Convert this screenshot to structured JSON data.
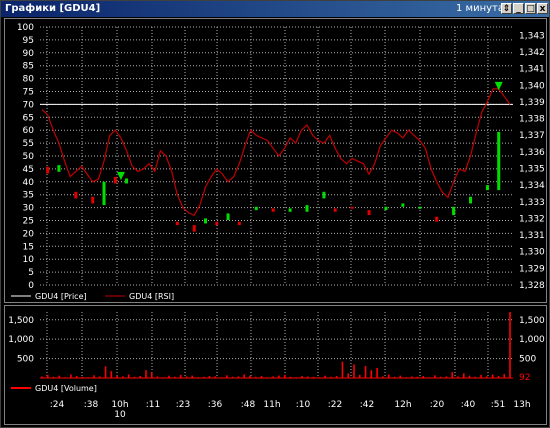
{
  "window": {
    "title": "Графики [GDU4]",
    "timeframe": "1 минута",
    "buttons": [
      "⇕",
      "_",
      "□",
      "x"
    ]
  },
  "colors": {
    "background": "#000000",
    "grid": "#b0b0b0",
    "price_up": "#00e000",
    "price_down": "#e00000",
    "rsi_line": "#c00000",
    "rsi_level": "#ffffff",
    "volume": "#ff0000",
    "text": "#ffffff"
  },
  "chart_data": [
    {
      "type": "line",
      "title": "",
      "left_axis": {
        "ylim": [
          0,
          100
        ],
        "ticks": [
          "0",
          "5",
          "10",
          "15",
          "20",
          "25",
          "30",
          "35",
          "40",
          "45",
          "50",
          "55",
          "60",
          "65",
          "70",
          "75",
          "80",
          "85",
          "90",
          "95",
          "100"
        ]
      },
      "right_axis": {
        "ylim": [
          1.328,
          1.3435
        ],
        "ticks": [
          "1,328",
          "1,329",
          "1,330",
          "1,331",
          "1,332",
          "1,333",
          "1,334",
          "1,335",
          "1,336",
          "1,337",
          "1,338",
          "1,339",
          "1,340",
          "1,341",
          "1,342",
          "1,343"
        ]
      },
      "rsi_level": 70,
      "grid": true,
      "legend": [
        "GDU4 [Price]",
        "GDU4 [RSI]"
      ],
      "legend_placement": "bottom-left",
      "series": [
        {
          "name": "GDU4 [RSI]",
          "values": [
            68,
            66,
            60,
            55,
            48,
            42,
            44,
            46,
            43,
            40,
            41,
            48,
            58,
            60,
            57,
            52,
            46,
            44,
            45,
            47,
            44,
            52,
            50,
            44,
            35,
            30,
            28,
            27,
            31,
            38,
            42,
            45,
            43,
            40,
            42,
            47,
            54,
            60,
            58,
            57,
            56,
            53,
            50,
            53,
            57,
            55,
            60,
            62,
            58,
            56,
            55,
            58,
            53,
            49,
            47,
            49,
            48,
            47,
            43,
            47,
            54,
            57,
            60,
            59,
            57,
            60,
            58,
            56,
            53,
            45,
            40,
            36,
            34,
            40,
            45,
            44,
            50,
            59,
            67,
            71,
            76,
            76,
            73,
            70
          ]
        },
        {
          "name": "GDU4 [Price]",
          "type": "candlestick",
          "candles": [
            {
              "i": 1,
              "o": 1.3351,
              "c": 1.3347
            },
            {
              "i": 3,
              "o": 1.3348,
              "c": 1.3352
            },
            {
              "i": 6,
              "o": 1.3336,
              "c": 1.3332
            },
            {
              "i": 9,
              "o": 1.3333,
              "c": 1.3329
            },
            {
              "i": 11,
              "o": 1.3328,
              "c": 1.3342
            },
            {
              "i": 13,
              "o": 1.3345,
              "c": 1.3341
            },
            {
              "i": 15,
              "o": 1.3341,
              "c": 1.3344
            },
            {
              "i": 24,
              "o": 1.3318,
              "c": 1.3316
            },
            {
              "i": 27,
              "o": 1.3316,
              "c": 1.3312
            },
            {
              "i": 29,
              "o": 1.3317,
              "c": 1.332
            },
            {
              "i": 31,
              "o": 1.3318,
              "c": 1.3316
            },
            {
              "i": 33,
              "o": 1.3319,
              "c": 1.3323
            },
            {
              "i": 35,
              "o": 1.3318,
              "c": 1.3316
            },
            {
              "i": 38,
              "o": 1.3325,
              "c": 1.3327
            },
            {
              "i": 41,
              "o": 1.3326,
              "c": 1.3324
            },
            {
              "i": 44,
              "o": 1.3324,
              "c": 1.3326
            },
            {
              "i": 47,
              "o": 1.3324,
              "c": 1.3328
            },
            {
              "i": 50,
              "o": 1.3332,
              "c": 1.3336
            },
            {
              "i": 52,
              "o": 1.3326,
              "c": 1.3324
            },
            {
              "i": 55,
              "o": 1.3327,
              "c": 1.3326
            },
            {
              "i": 58,
              "o": 1.3325,
              "c": 1.3322
            },
            {
              "i": 61,
              "o": 1.3325,
              "c": 1.3327
            },
            {
              "i": 64,
              "o": 1.3327,
              "c": 1.3329
            },
            {
              "i": 67,
              "o": 1.3326,
              "c": 1.3327
            },
            {
              "i": 70,
              "o": 1.3321,
              "c": 1.3318
            },
            {
              "i": 73,
              "o": 1.3322,
              "c": 1.3327
            },
            {
              "i": 76,
              "o": 1.3329,
              "c": 1.3333
            },
            {
              "i": 79,
              "o": 1.3337,
              "c": 1.334
            },
            {
              "i": 81,
              "o": 1.3337,
              "c": 1.3372
            }
          ]
        }
      ]
    },
    {
      "type": "bar",
      "title": "",
      "legend": [
        "GDU4 [Volume]"
      ],
      "legend_placement": "bottom-left",
      "ylim": [
        0,
        1700
      ],
      "ticks": [
        "1,500",
        "1,000",
        "500"
      ],
      "last_value": "92",
      "values": [
        40,
        80,
        30,
        60,
        20,
        90,
        50,
        30,
        20,
        70,
        40,
        300,
        180,
        60,
        40,
        90,
        30,
        50,
        200,
        150,
        40,
        20,
        60,
        30,
        80,
        40,
        60,
        20,
        30,
        50,
        40,
        20,
        70,
        30,
        40,
        90,
        60,
        30,
        50,
        20,
        40,
        60,
        80,
        30,
        20,
        50,
        40,
        30,
        20,
        60,
        30,
        50,
        420,
        120,
        350,
        80,
        310,
        200,
        260,
        40,
        90,
        30,
        60,
        20,
        40,
        30,
        50,
        20,
        70,
        30,
        40,
        150,
        40,
        120,
        60,
        30,
        80,
        40,
        90,
        50,
        100,
        1700
      ]
    }
  ],
  "x_axis": {
    "ticks": [
      ":24",
      ":38",
      "10h",
      ":11",
      ":23",
      ":36",
      ":48",
      "11h",
      ":10",
      ":22",
      ":42",
      "12h",
      ":20",
      ":40",
      ":51",
      "13h"
    ],
    "sub_label": "10"
  }
}
